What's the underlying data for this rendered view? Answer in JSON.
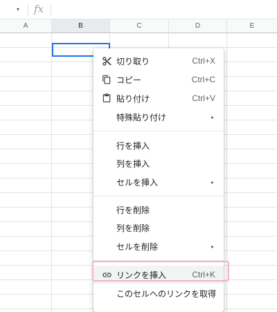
{
  "formula_bar": {
    "dropdown_glyph": "▾",
    "fx_label": "fx"
  },
  "columns": [
    {
      "label": "A"
    },
    {
      "label": "B"
    },
    {
      "label": "C"
    },
    {
      "label": "D"
    },
    {
      "label": "E"
    }
  ],
  "context_menu": {
    "items": [
      {
        "label": "切り取り",
        "shortcut": "Ctrl+X",
        "icon": "scissors-icon"
      },
      {
        "label": "コピー",
        "shortcut": "Ctrl+C",
        "icon": "copy-icon"
      },
      {
        "label": "貼り付け",
        "shortcut": "Ctrl+V",
        "icon": "paste-icon"
      },
      {
        "label": "特殊貼り付け",
        "submenu": true
      },
      {
        "label": "行を挿入"
      },
      {
        "label": "列を挿入"
      },
      {
        "label": "セルを挿入",
        "submenu": true
      },
      {
        "label": "行を削除"
      },
      {
        "label": "列を削除"
      },
      {
        "label": "セルを削除",
        "submenu": true
      },
      {
        "label": "リンクを挿入",
        "shortcut": "Ctrl+K",
        "icon": "link-icon",
        "highlighted": true
      },
      {
        "label": "このセルへのリンクを取得"
      }
    ],
    "submenu_arrow": "▸"
  },
  "colors": {
    "accent": "#1a73e8",
    "highlight_box": "#f4b3c9"
  }
}
